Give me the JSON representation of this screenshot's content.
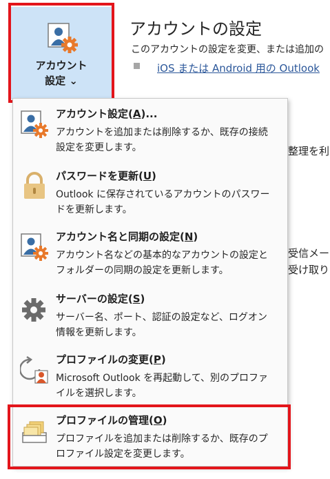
{
  "account_button": {
    "line1": "アカウント",
    "line2": "設定 ⌄"
  },
  "page": {
    "title": "アカウントの設定",
    "description": "このアカウントの設定を変更、または追加の",
    "link": "iOS または Android 用の Outlook"
  },
  "background_fragments": [
    "整理を利",
    "受信メー",
    "受け取りま"
  ],
  "menu": {
    "items": [
      {
        "title": "アカウント設定(",
        "accel": "A",
        "title_end": ")...",
        "desc": "アカウントを追加または削除するか、既存の接続設定を変更します。",
        "icon": "account-settings-icon"
      },
      {
        "title": "パスワードを更新(",
        "accel": "U",
        "title_end": ")",
        "desc": "Outlook に保存されているアカウントのパスワードを更新します。",
        "icon": "lock-icon"
      },
      {
        "title": "アカウント名と同期の設定(",
        "accel": "N",
        "title_end": ")",
        "desc": "アカウント名などの基本的なアカウントの設定とフォルダーの同期の設定を更新します。",
        "icon": "account-sync-icon"
      },
      {
        "title": "サーバーの設定(",
        "accel": "S",
        "title_end": ")",
        "desc": "サーバー名、ポート、認証の設定など、ログオン情報を更新します。",
        "icon": "gear-icon"
      },
      {
        "title": "プロファイルの変更(",
        "accel": "P",
        "title_end": ")",
        "desc": "Microsoft Outlook を再起動して、別のプロファイルを選択します。",
        "icon": "change-profile-icon"
      },
      {
        "title": "プロファイルの管理(",
        "accel": "O",
        "title_end": ")",
        "desc": "プロファイルを追加または削除するか、既存のプロファイル設定を変更します。",
        "icon": "manage-profiles-icon"
      }
    ]
  },
  "colors": {
    "highlight_frame": "#e3151b",
    "button_bg": "#cde3f7",
    "link": "#2b579a",
    "gear_orange": "#e8792b",
    "person_blue": "#3a6ea5"
  }
}
